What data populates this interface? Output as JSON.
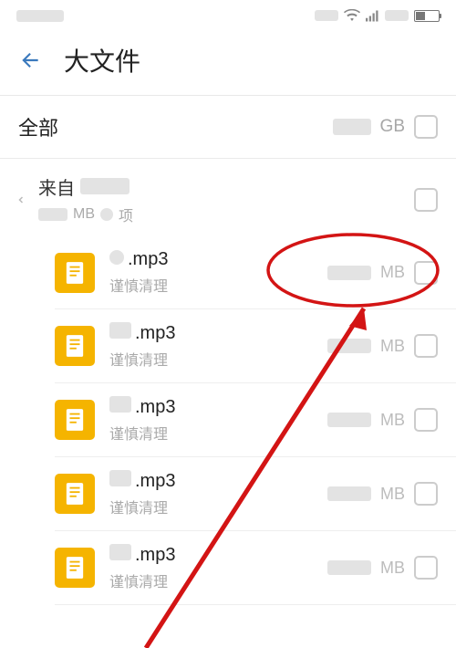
{
  "statusbar": {
    "wifi": true,
    "signal": true,
    "battery": 40
  },
  "header": {
    "title": "大文件"
  },
  "all": {
    "label": "全部",
    "size_unit": "GB"
  },
  "group": {
    "prefix": "来自",
    "sub_size_unit": "MB",
    "sub_count_unit": "项"
  },
  "files": [
    {
      "ext": ".mp3",
      "caution": "谨慎清理",
      "size_unit": "MB"
    },
    {
      "ext": ".mp3",
      "caution": "谨慎清理",
      "size_unit": "MB"
    },
    {
      "ext": ".mp3",
      "caution": "谨慎清理",
      "size_unit": "MB"
    },
    {
      "ext": ".mp3",
      "caution": "谨慎清理",
      "size_unit": "MB"
    },
    {
      "ext": ".mp3",
      "caution": "谨慎清理",
      "size_unit": "MB"
    }
  ],
  "annotation": {
    "ellipse": true,
    "arrow": true
  }
}
